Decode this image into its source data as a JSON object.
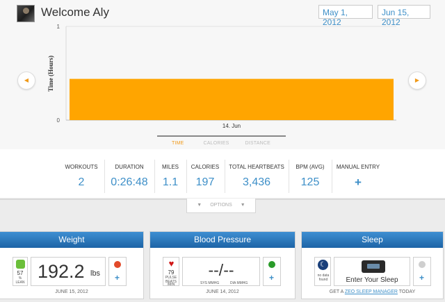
{
  "header": {
    "welcome": "Welcome Aly",
    "date_start": "May 1, 2012",
    "date_end": "Jun 15, 2012"
  },
  "chart_data": {
    "type": "bar",
    "categories": [
      "14. Jun"
    ],
    "values": [
      0.44
    ],
    "ylabel": "Time (Hours)",
    "xlabel": "",
    "ylim": [
      0,
      1
    ],
    "yticks": [
      "0",
      "1"
    ],
    "bar_color": "#ffa500",
    "grid": "horizontal"
  },
  "nav": {
    "prev_icon": "triangle-left",
    "next_icon": "triangle-right",
    "accent": "#f09a1a"
  },
  "tabs": [
    {
      "label": "TIME",
      "active": true
    },
    {
      "label": "CALORIES",
      "active": false
    },
    {
      "label": "DISTANCE",
      "active": false
    }
  ],
  "stats": {
    "workouts": {
      "label": "WORKOUTS",
      "value": "2"
    },
    "duration": {
      "label": "DURATION",
      "value": "0:26:48"
    },
    "miles": {
      "label": "MILES",
      "value": "1.1"
    },
    "calories": {
      "label": "CALORIES",
      "value": "197"
    },
    "heartbeats": {
      "label": "TOTAL HEARTBEATS",
      "value": "3,436"
    },
    "bpm": {
      "label": "BPM (AVG)",
      "value": "125"
    },
    "manual": {
      "label": "MANUAL ENTRY",
      "value": "+"
    }
  },
  "options_label": "OPTIONS",
  "weight": {
    "title": "Weight",
    "score": "57",
    "score_unit": "%",
    "score_label": "LEAN",
    "value": "192.2",
    "unit": "lbs",
    "plus": "+",
    "date": "JUNE 15, 2012",
    "status_color": "#e24a2a"
  },
  "bp": {
    "title": "Blood Pressure",
    "pulse": "79",
    "pulse_label": "PULSE BEATS",
    "pulse_unit": "/MIN",
    "value": "--/--",
    "sys_label": "SYS MMHG",
    "dia_label": "DIA MMHG",
    "plus": "+",
    "date": "JUNE 14, 2012",
    "status_color": "#2a9b2a"
  },
  "sleep": {
    "title": "Sleep",
    "no_data": "no data found",
    "enter": "Enter Your Sleep",
    "plus": "+",
    "foot_prefix": "GET A",
    "foot_link": "ZEO SLEEP MANAGER",
    "foot_suffix": "TODAY",
    "status_color": "#cfcfcf"
  },
  "colors": {
    "accent_blue": "#3d8fc8",
    "header_blue": "#1d64a6",
    "orange": "#ffa500"
  }
}
